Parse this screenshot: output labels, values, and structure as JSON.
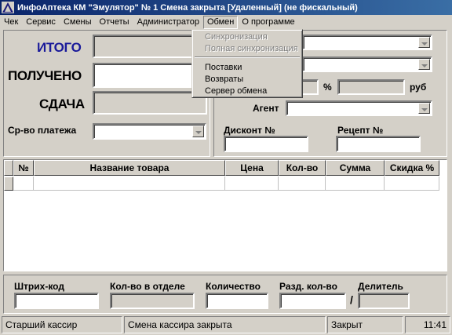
{
  "window": {
    "title": "ИнфоАптека КМ \"Эмулятор\" № 1 Смена закрыта [Удаленный] (не фискальный)"
  },
  "menu": {
    "items": [
      "Чек",
      "Сервис",
      "Смены",
      "Отчеты",
      "Администратор",
      "Обмен",
      "О программе"
    ],
    "active": "Обмен"
  },
  "dropdown": {
    "items": [
      {
        "label": "Синхронизация",
        "disabled": true
      },
      {
        "label": "Полная синхронизация",
        "disabled": true
      },
      {
        "label": "Поставки",
        "disabled": false
      },
      {
        "label": "Возвраты",
        "disabled": false
      },
      {
        "label": "Сервер обмена",
        "disabled": false
      }
    ]
  },
  "totals": {
    "itogo_label": "ИТОГО",
    "received_label": "ПОЛУЧЕНО",
    "change_label": "СДАЧА",
    "payment_label": "Ср-во платежа"
  },
  "right_panel": {
    "percent_symbol": "%",
    "currency": "руб",
    "agent_label": "Агент",
    "discount_label": "Дисконт №",
    "recipe_label": "Рецепт №"
  },
  "grid": {
    "columns": [
      "№",
      "Название товара",
      "Цена",
      "Кол-во",
      "Сумма",
      "Скидка %"
    ]
  },
  "bottom": {
    "barcode_label": "Штрих-код",
    "dept_qty_label": "Кол-во в отделе",
    "qty_label": "Количество",
    "split_qty_label": "Разд. кол-во",
    "slash": "/",
    "divisor_label": "Делитель"
  },
  "statusbar": {
    "cashier": "Старший кассир",
    "shift_status": "Смена кассира закрыта",
    "state": "Закрыт",
    "time": "11:41"
  },
  "colors": {
    "title_gradient_start": "#0a246a",
    "title_gradient_end": "#3a6ea5",
    "itogo_color": "#1a1a9a",
    "face": "#d4d0c8"
  }
}
